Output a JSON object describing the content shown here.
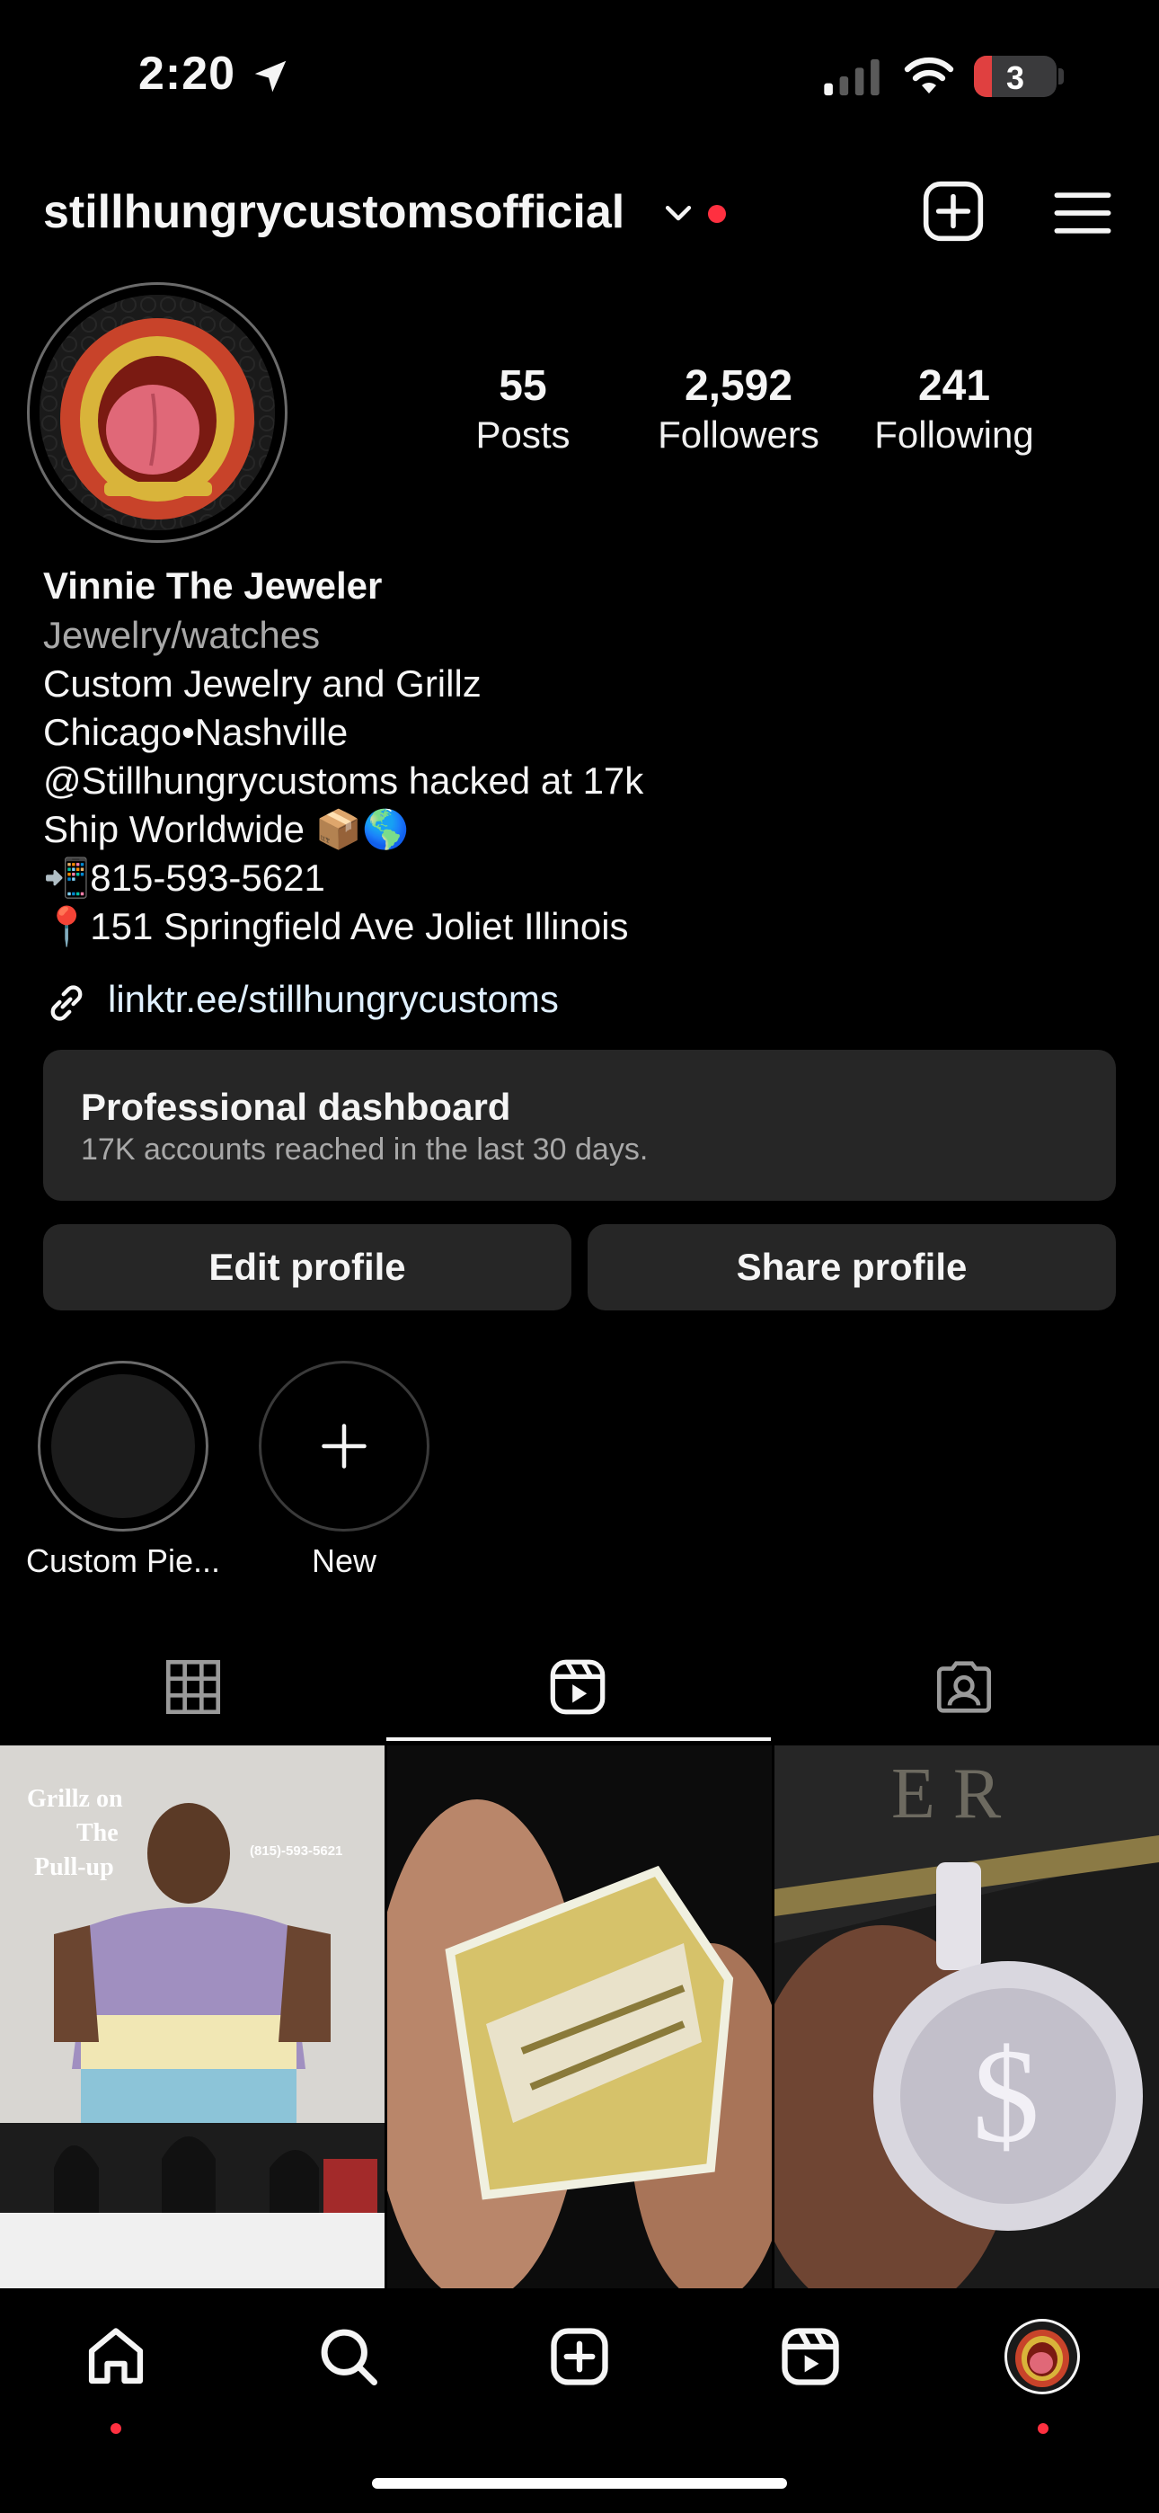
{
  "status_bar": {
    "time": "2:20",
    "battery": "3",
    "battery_level": 0.22
  },
  "header": {
    "username": "stillhungrycustomsofficial"
  },
  "stats": [
    {
      "num": "55",
      "label": "Posts"
    },
    {
      "num": "2,592",
      "label": "Followers"
    },
    {
      "num": "241",
      "label": "Following"
    }
  ],
  "bio": {
    "name": "Vinnie The Jeweler",
    "category": "Jewelry/watches",
    "lines": [
      "Custom Jewelry and Grillz",
      "Chicago•Nashville",
      "@Stillhungrycustoms hacked at 17k",
      "Ship Worldwide 📦🌎",
      "📲815-593-5621",
      "📍151 Springfield Ave Joliet Illinois"
    ],
    "link": "linktr.ee/stillhungrycustoms"
  },
  "dashboard": {
    "title": "Professional dashboard",
    "subtitle": "17K accounts reached in the last 30 days."
  },
  "buttons": {
    "edit": "Edit profile",
    "share": "Share profile"
  },
  "highlights": [
    {
      "label": "Custom Pie..."
    },
    {
      "label": "New"
    }
  ],
  "grid": {
    "tile1_text": [
      "Grillz on",
      "The",
      "Pull-up"
    ],
    "tile1_phone": "(815)-593-5621"
  },
  "colors": {
    "accent_dot": "#ff3040",
    "card_bg": "#262626"
  }
}
